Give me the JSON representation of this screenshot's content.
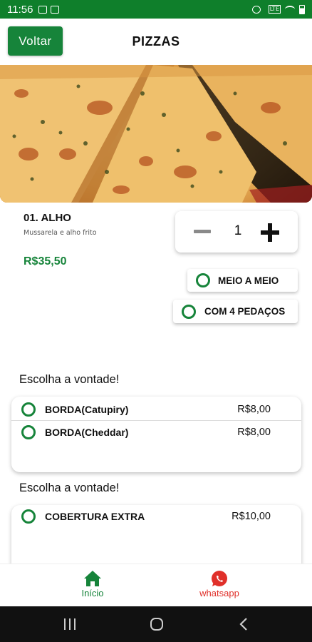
{
  "status_bar": {
    "time": "11:56"
  },
  "header": {
    "back_label": "Voltar",
    "title": "PIZZAS"
  },
  "product": {
    "name": "01. ALHO",
    "description": "Mussarela e alho frito",
    "price": "R$35,50",
    "quantity": "1"
  },
  "options": {
    "half_half": "MEIO A MEIO",
    "four_pieces": "COM 4 PEDAÇOS"
  },
  "extras_group_1": {
    "title": "Escolha a vontade!",
    "items": [
      {
        "label": "BORDA(Catupiry)",
        "price": "R$8,00"
      },
      {
        "label": "BORDA(Cheddar)",
        "price": "R$8,00"
      }
    ]
  },
  "extras_group_2": {
    "title": "Escolha a vontade!",
    "items": [
      {
        "label": "COBERTURA EXTRA",
        "price": "R$10,00"
      }
    ]
  },
  "bottom_nav": {
    "home_label": "Início",
    "whatsapp_label": "whatsapp"
  },
  "colors": {
    "brand_green": "#16843a",
    "status_bar_green": "#0f7f2b",
    "whatsapp_red": "#e0302a"
  },
  "icons": [
    "gallery-icon",
    "sd-card-icon",
    "alarm-icon",
    "lte-icon",
    "wifi-icon",
    "battery-icon",
    "home-icon",
    "whatsapp-icon",
    "recents-icon",
    "home-circle-icon",
    "back-icon"
  ]
}
